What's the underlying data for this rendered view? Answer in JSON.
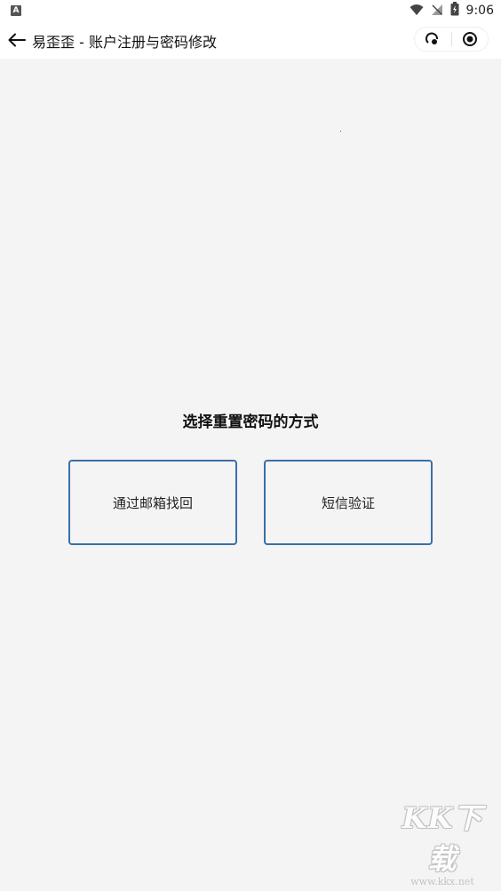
{
  "status_bar": {
    "app_icon_letter": "A",
    "time": "9:06"
  },
  "nav": {
    "title": "易歪歪 - 账户注册与密码修改"
  },
  "main": {
    "heading": "选择重置密码的方式",
    "options": [
      {
        "label": "通过邮箱找回"
      },
      {
        "label": "短信验证"
      }
    ],
    "accent_color": "#3b6ea8"
  },
  "watermark": {
    "logo": "KK下载",
    "url": "www.kkx.net"
  }
}
